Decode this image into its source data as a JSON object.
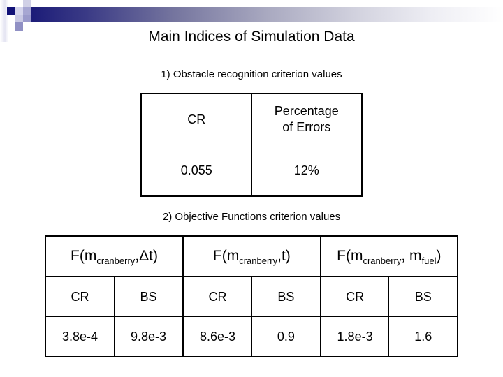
{
  "slide": {
    "title": "Main Indices of Simulation Data",
    "decoration": {
      "colors": {
        "navy": "#111177",
        "lavender_light": "#d4d4ec",
        "lavender_medium": "#a6a6d2",
        "bar_start": "#1c1c78",
        "bar_end": "#ffffff"
      }
    }
  },
  "section1": {
    "heading": "1) Obstacle recognition criterion values",
    "table": {
      "headers": [
        "CR",
        "Percentage of Errors"
      ],
      "rows": [
        [
          "0.055",
          "12%"
        ]
      ]
    }
  },
  "section2": {
    "heading": "2) Objective Functions criterion values",
    "table": {
      "groups": [
        {
          "prefix": "F(m",
          "sub1": "cranberry",
          "mid": ",Δt)",
          "sub2": "",
          "suffix": ""
        },
        {
          "prefix": "F(m",
          "sub1": "cranberry",
          "mid": ",t)",
          "sub2": "",
          "suffix": ""
        },
        {
          "prefix": "F(m",
          "sub1": "cranberry",
          "mid": ", m",
          "sub2": "fuel",
          "suffix": ")"
        }
      ],
      "subheaders": [
        "CR",
        "BS",
        "CR",
        "BS",
        "CR",
        "BS"
      ],
      "values": [
        "3.8e-4",
        "9.8e-3",
        "8.6e-3",
        "0.9",
        "1.8e-3",
        "1.6"
      ]
    }
  }
}
